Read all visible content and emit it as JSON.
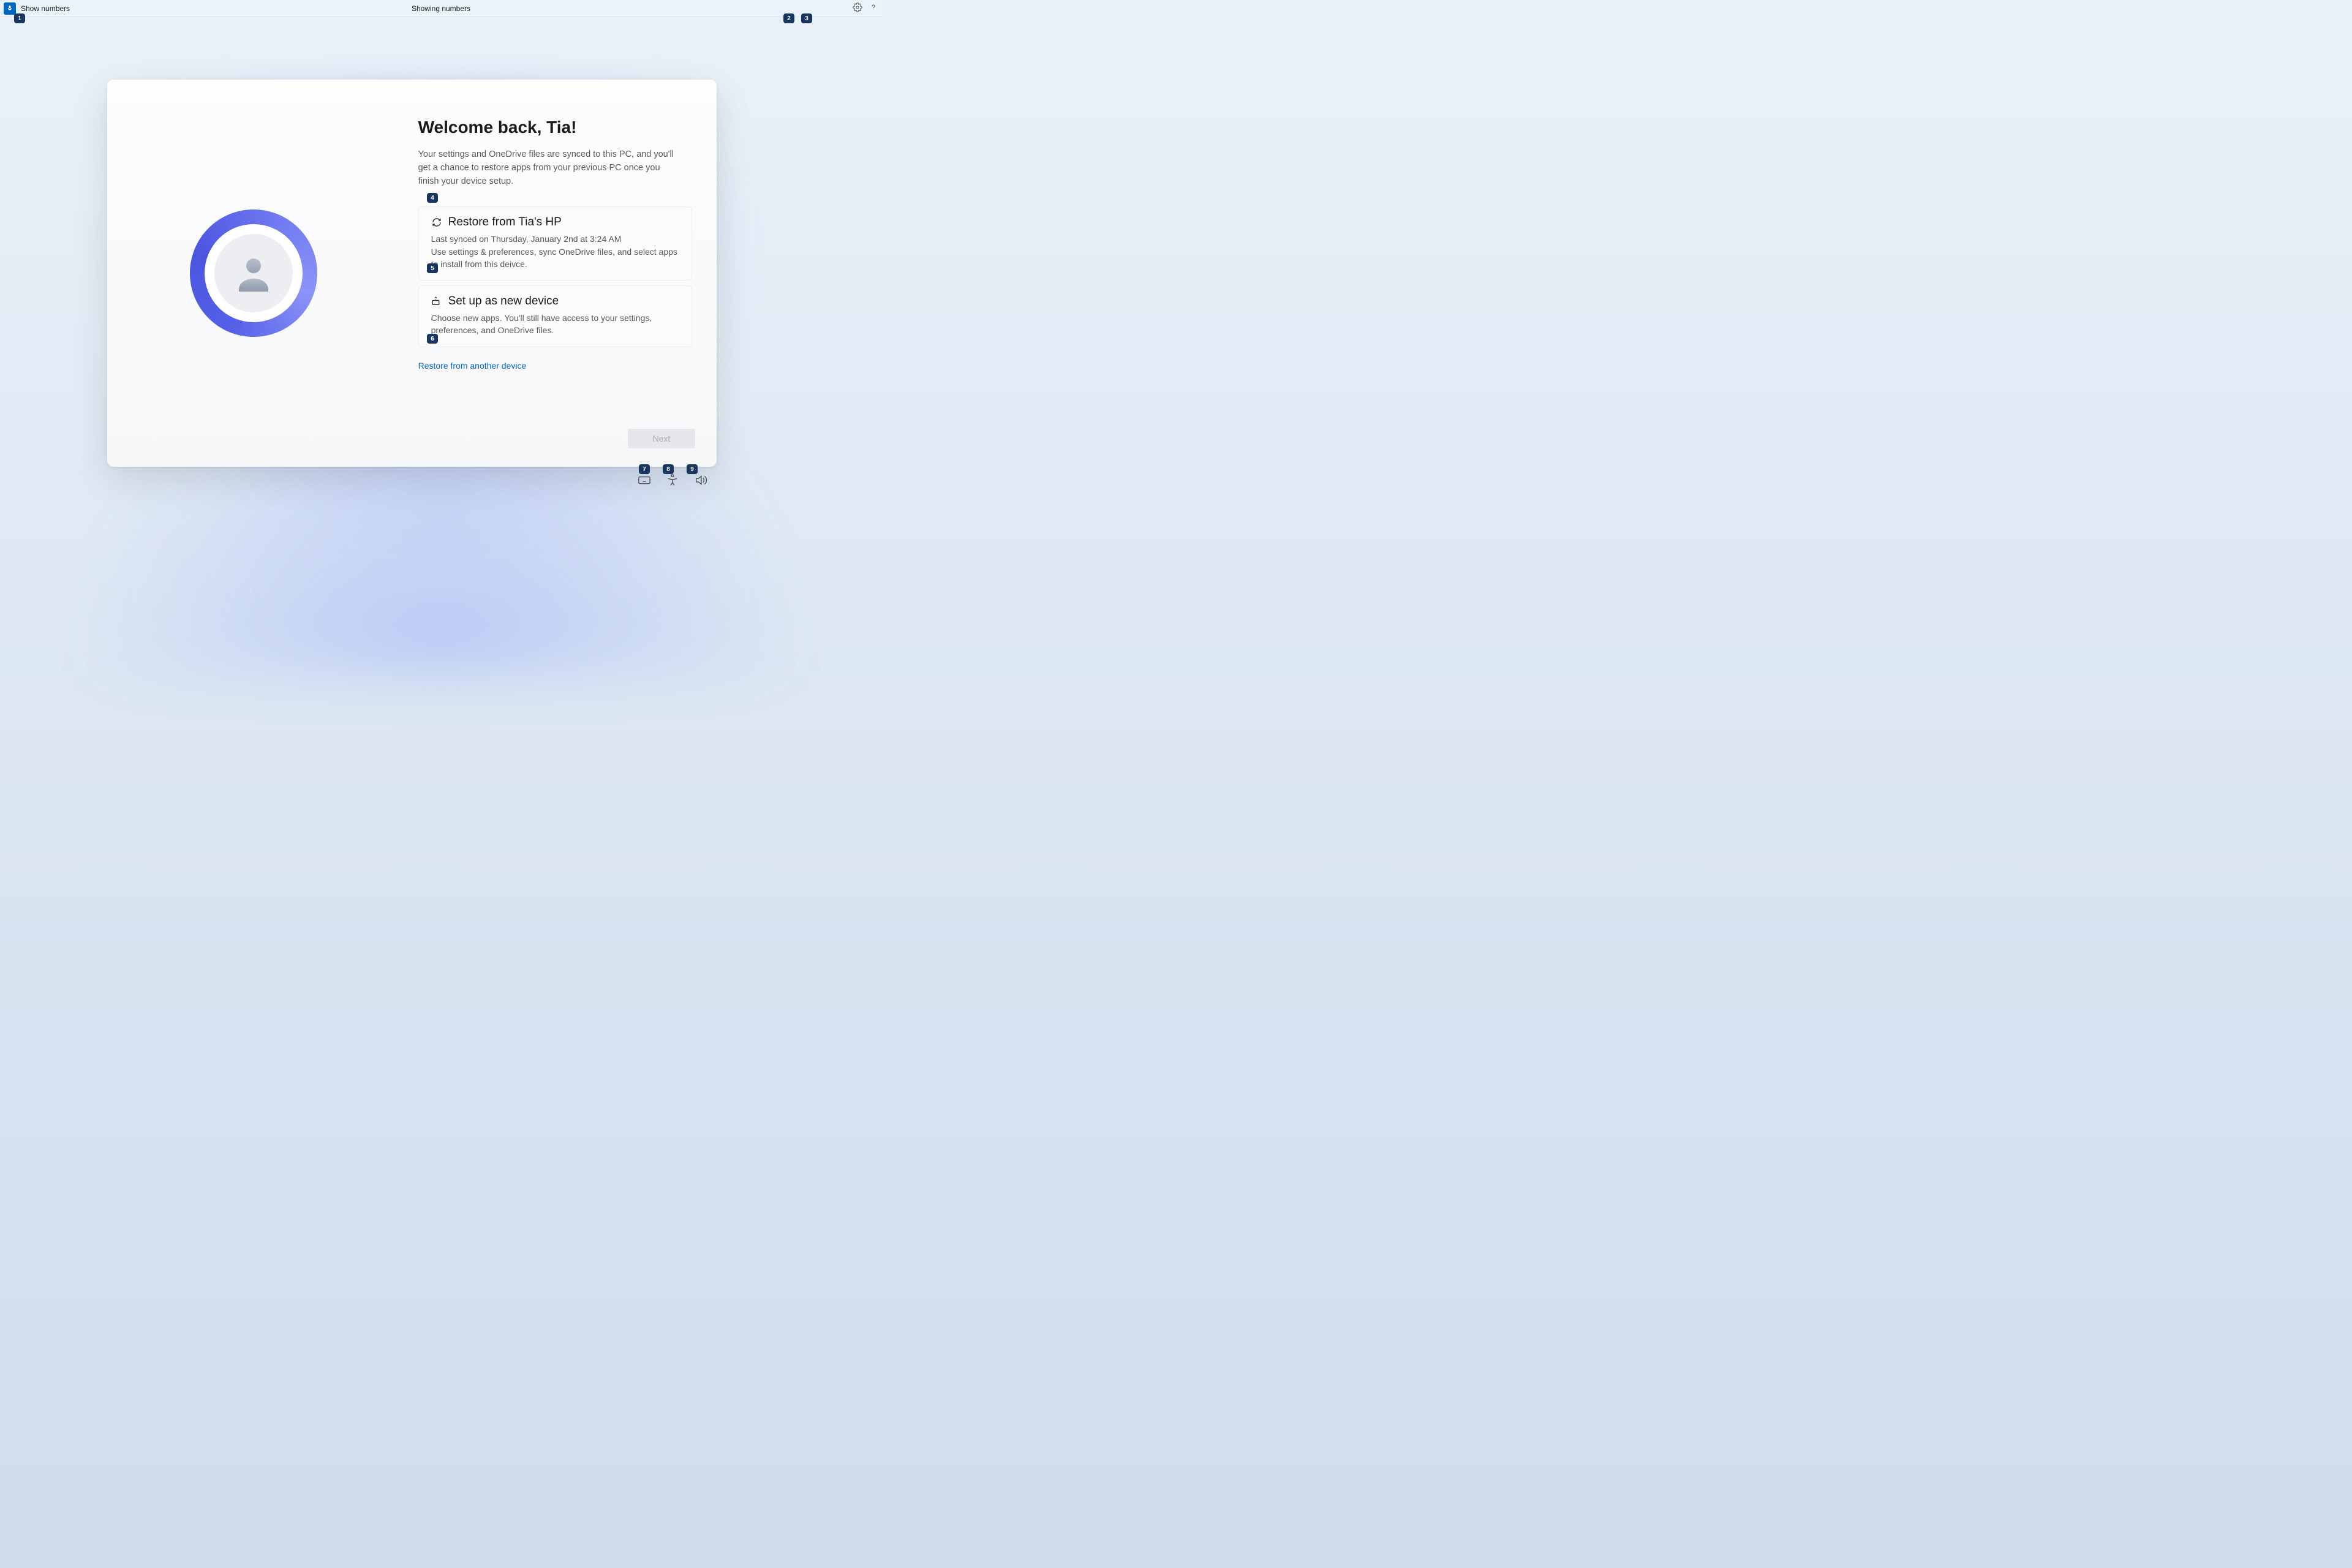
{
  "topbar": {
    "left_text": "Show numbers",
    "center_text": "Showing numbers"
  },
  "numbers": {
    "n1": "1",
    "n2": "2",
    "n3": "3",
    "n4": "4",
    "n5": "5",
    "n6": "6",
    "n7": "7",
    "n8": "8",
    "n9": "9"
  },
  "main": {
    "title": "Welcome back, Tia!",
    "subtitle": "Your settings and OneDrive files are synced to this PC, and you'll get a chance to restore apps from your previous PC once you finish your device setup.",
    "option_restore": {
      "title": "Restore from Tia's HP",
      "line1": "Last synced on Thursday, January 2nd at 3:24 AM",
      "line2": "Use settings & preferences, sync OneDrive files, and select apps to install from this deivce."
    },
    "option_new": {
      "title": "Set up as new device",
      "desc": "Choose new apps. You'll still have access to your settings, preferences, and OneDrive files."
    },
    "link_another": "Restore from another device",
    "next_label": "Next"
  },
  "icons": {
    "mic": "microphone-icon",
    "settings": "gear-icon",
    "help": "help-icon",
    "sync": "sync-icon",
    "device": "device-icon",
    "keyboard": "keyboard-icon",
    "accessibility": "accessibility-icon",
    "volume": "volume-icon"
  }
}
